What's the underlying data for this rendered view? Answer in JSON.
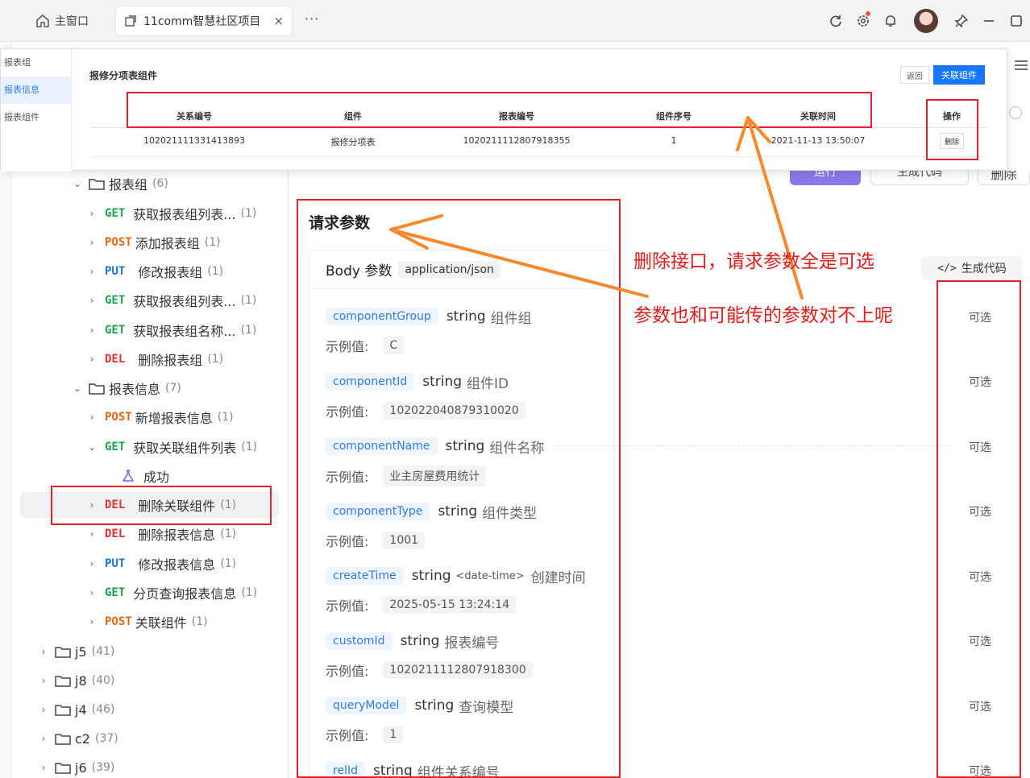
{
  "titlebar": {
    "home_label": "主窗口",
    "tab_title": "11comm智慧社区项目",
    "close_glyph": "×",
    "more_glyph": "···"
  },
  "popup": {
    "nav": [
      "报表组",
      "报表信息",
      "报表组件"
    ],
    "title": "报修分项表组件",
    "back_label": "返回",
    "link_label": "关联组件",
    "columns": [
      "关系编号",
      "组件",
      "报表编号",
      "组件序号",
      "关联时间",
      "操作"
    ],
    "row": [
      "102021111331413893",
      "报修分项表",
      "1020211112807918355",
      "1",
      "2021-11-13 13:50:07"
    ],
    "delete_label": "删除"
  },
  "header": {
    "run_label": "运行",
    "gen_code_top_label": "生成代码",
    "delete_label": "删除",
    "gen_code_label": "生成代码"
  },
  "tree": {
    "group": {
      "name": "报表组",
      "count": "(6)"
    },
    "group_items": [
      {
        "method": "GET",
        "label": "获取报表组列表...",
        "count": "(1)"
      },
      {
        "method": "POST",
        "label": "添加报表组",
        "count": "(1)"
      },
      {
        "method": "PUT",
        "label": "修改报表组",
        "count": "(1)"
      },
      {
        "method": "GET",
        "label": "获取报表组列表...",
        "count": "(1)"
      },
      {
        "method": "GET",
        "label": "获取报表组名称...",
        "count": "(1)"
      },
      {
        "method": "DEL",
        "label": "删除报表组",
        "count": "(1)"
      }
    ],
    "info": {
      "name": "报表信息",
      "count": "(7)"
    },
    "info_items": [
      {
        "method": "POST",
        "label": "新增报表信息",
        "count": "(1)"
      },
      {
        "method": "GET",
        "label": "获取关联组件列表",
        "count": "(1)"
      },
      {
        "method": "DEL",
        "label": "删除关联组件",
        "count": "(1)"
      },
      {
        "method": "DEL",
        "label": "删除报表信息",
        "count": "(1)"
      },
      {
        "method": "PUT",
        "label": "修改报表信息",
        "count": "(1)"
      },
      {
        "method": "GET",
        "label": "分页查询报表信息",
        "count": "(1)"
      },
      {
        "method": "POST",
        "label": "关联组件",
        "count": "(1)"
      }
    ],
    "success_label": "成功",
    "folders": [
      {
        "name": "j5",
        "count": "(41)"
      },
      {
        "name": "j8",
        "count": "(40)"
      },
      {
        "name": "j4",
        "count": "(46)"
      },
      {
        "name": "c2",
        "count": "(37)"
      },
      {
        "name": "j6",
        "count": "(39)"
      }
    ]
  },
  "params": {
    "title": "请求参数",
    "body_label": "Body 参数",
    "content_type": "application/json",
    "example_label": "示例值:",
    "optional_label": "可选",
    "items": [
      {
        "name": "componentGroup",
        "type": "string",
        "format": "",
        "desc": "组件组",
        "example": "C"
      },
      {
        "name": "componentId",
        "type": "string",
        "format": "",
        "desc": "组件ID",
        "example": "102022040879310020"
      },
      {
        "name": "componentName",
        "type": "string",
        "format": "",
        "desc": "组件名称",
        "example": "业主房屋费用统计"
      },
      {
        "name": "componentType",
        "type": "string",
        "format": "",
        "desc": "组件类型",
        "example": "1001"
      },
      {
        "name": "createTime",
        "type": "string",
        "format": "<date-time>",
        "desc": "创建时间",
        "example": "2025-05-15 13:24:14"
      },
      {
        "name": "customId",
        "type": "string",
        "format": "",
        "desc": "报表编号",
        "example": "1020211112807918300"
      },
      {
        "name": "queryModel",
        "type": "string",
        "format": "",
        "desc": "查询模型",
        "example": "1"
      },
      {
        "name": "relId",
        "type": "string",
        "format": "",
        "desc": "组件关系编号",
        "example": ""
      }
    ]
  },
  "annotations": {
    "note1": "删除接口，请求参数全是可选",
    "note2": "参数也和可能传的参数对不上呢"
  },
  "colors": {
    "get": "#17a34a",
    "post": "#e8640c",
    "put": "#1e73d8",
    "del": "#e03131",
    "annotation_red": "#e0202a",
    "arrow_orange": "#f7892c",
    "primary_blue": "#1677ff"
  }
}
